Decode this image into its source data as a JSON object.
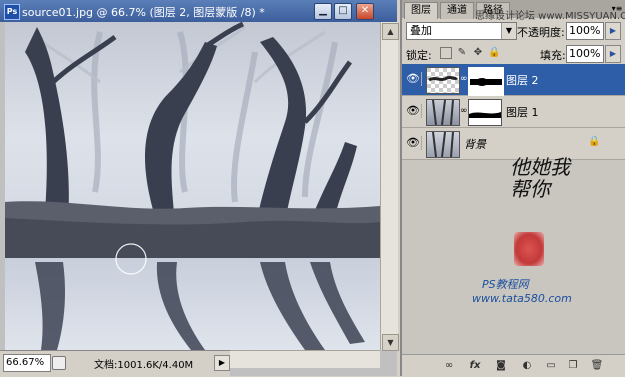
{
  "document": {
    "title": "source01.jpg @ 66.7% (图层 2, 图层蒙版 /8) *",
    "app_icon": "Ps",
    "zoom": "66.67%",
    "doc_info": "文档:1001.6K/4.40M",
    "window_buttons": {
      "minimize": "▁",
      "maximize": "□",
      "close": "✕"
    }
  },
  "panel": {
    "tabs": [
      "图层",
      "通道",
      "路径"
    ],
    "site_watermark": "思缘设计论坛 www.MISSYUAN.COM",
    "blend_mode": "叠加",
    "opacity_label": "不透明度:",
    "opacity_value": "100%",
    "lock_label": "锁定:",
    "fill_label": "填充:",
    "fill_value": "100%",
    "layers": [
      {
        "name": "图层 2",
        "selected": true,
        "has_mask": true
      },
      {
        "name": "图层 1",
        "selected": false,
        "has_mask": true
      },
      {
        "name": "背景",
        "selected": false,
        "has_mask": false,
        "locked": true
      }
    ],
    "watermark_text": "他她我帮你",
    "watermark_site": "PS教程网",
    "watermark_url": "www.tata580.com",
    "bottom_icons": [
      "link-icon",
      "fx-icon",
      "mask-icon",
      "adjustment-icon",
      "folder-icon",
      "new-layer-icon",
      "trash-icon"
    ]
  },
  "colors": {
    "title_bar": "#3c5f9c",
    "selected_layer": "#2e5ea8",
    "panel_bg": "#d4d0c8"
  }
}
